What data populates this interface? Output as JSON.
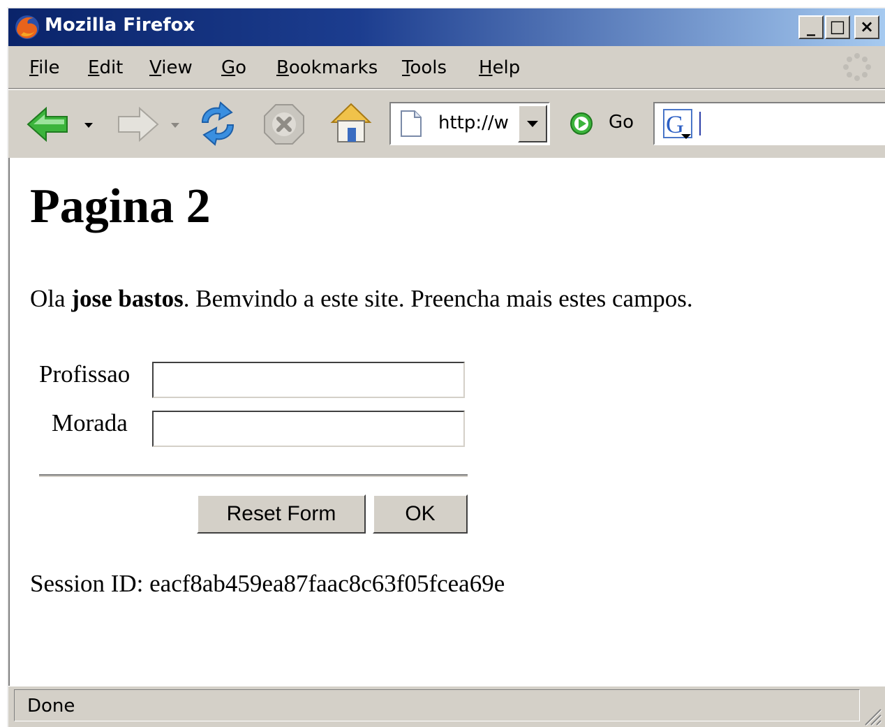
{
  "window": {
    "title": "Mozilla Firefox",
    "minimize_glyph": "_",
    "maximize_glyph": "□",
    "close_glyph": "×"
  },
  "menu": {
    "items": [
      {
        "label": "File",
        "mnemonic": "F"
      },
      {
        "label": "Edit",
        "mnemonic": "E"
      },
      {
        "label": "View",
        "mnemonic": "V"
      },
      {
        "label": "Go",
        "mnemonic": "G"
      },
      {
        "label": "Bookmarks",
        "mnemonic": "B"
      },
      {
        "label": "Tools",
        "mnemonic": "T"
      },
      {
        "label": "Help",
        "mnemonic": "H"
      }
    ]
  },
  "toolbar": {
    "back_icon": "back-arrow-icon",
    "forward_icon": "forward-arrow-icon",
    "reload_icon": "reload-icon",
    "stop_icon": "stop-icon",
    "home_icon": "home-icon",
    "address_value": "http://w",
    "go_label": "Go",
    "search_engine_icon": "google-icon",
    "search_value": ""
  },
  "page": {
    "heading": "Pagina 2",
    "greeting_prefix": "Ola ",
    "user_name": "jose bastos",
    "greeting_suffix": ". Bemvindo a este site. Preencha mais estes campos.",
    "form": {
      "profissao_label": "Profissao",
      "profissao_value": "",
      "morada_label": "Morada",
      "morada_value": "",
      "reset_label": "Reset Form",
      "ok_label": "OK"
    },
    "session_label": "Session ID: ",
    "session_id": "eacf8ab459ea87faac8c63f05fcea69e"
  },
  "status": {
    "text": "Done"
  },
  "colors": {
    "titlebar_start": "#0a246a",
    "titlebar_end": "#a6caf0",
    "chrome": "#d4d0c8",
    "back_arrow": "#3cb43c"
  }
}
